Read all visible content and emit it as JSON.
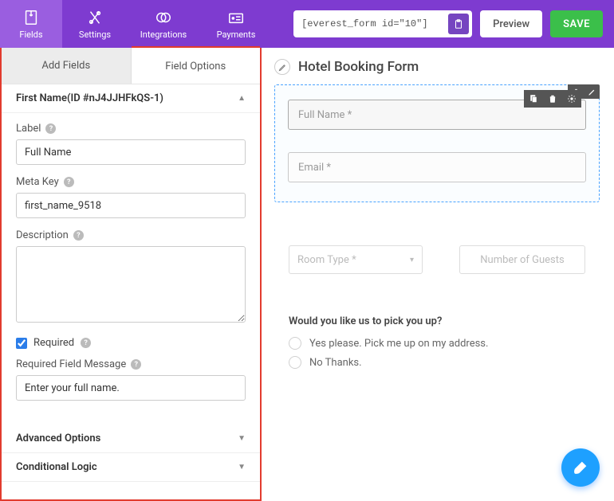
{
  "topnav": {
    "fields": "Fields",
    "settings": "Settings",
    "integrations": "Integrations",
    "payments": "Payments"
  },
  "shortcode": "[everest_form id=\"10\"]",
  "buttons": {
    "preview": "Preview",
    "save": "SAVE"
  },
  "tabs": {
    "add_fields": "Add Fields",
    "field_options": "Field Options"
  },
  "field_header": "First Name(ID #nJ4JJHFkQS-1)",
  "labels": {
    "label": "Label",
    "meta_key": "Meta Key",
    "description": "Description",
    "required": "Required",
    "required_msg": "Required Field Message"
  },
  "values": {
    "label": "Full Name",
    "meta_key": "first_name_9518",
    "description": "",
    "required": true,
    "required_msg": "Enter your full name."
  },
  "accordions": {
    "advanced": "Advanced Options",
    "conditional": "Conditional Logic"
  },
  "form": {
    "title": "Hotel Booking Form",
    "fullname_ph": "Full Name *",
    "email_ph": "Email *",
    "roomtype": "Room Type *",
    "numguests": "Number of Guests",
    "pickup_q": "Would you like us to pick you up?",
    "pickup_opts": [
      "Yes please. Pick me up on my address.",
      "No Thanks."
    ]
  }
}
